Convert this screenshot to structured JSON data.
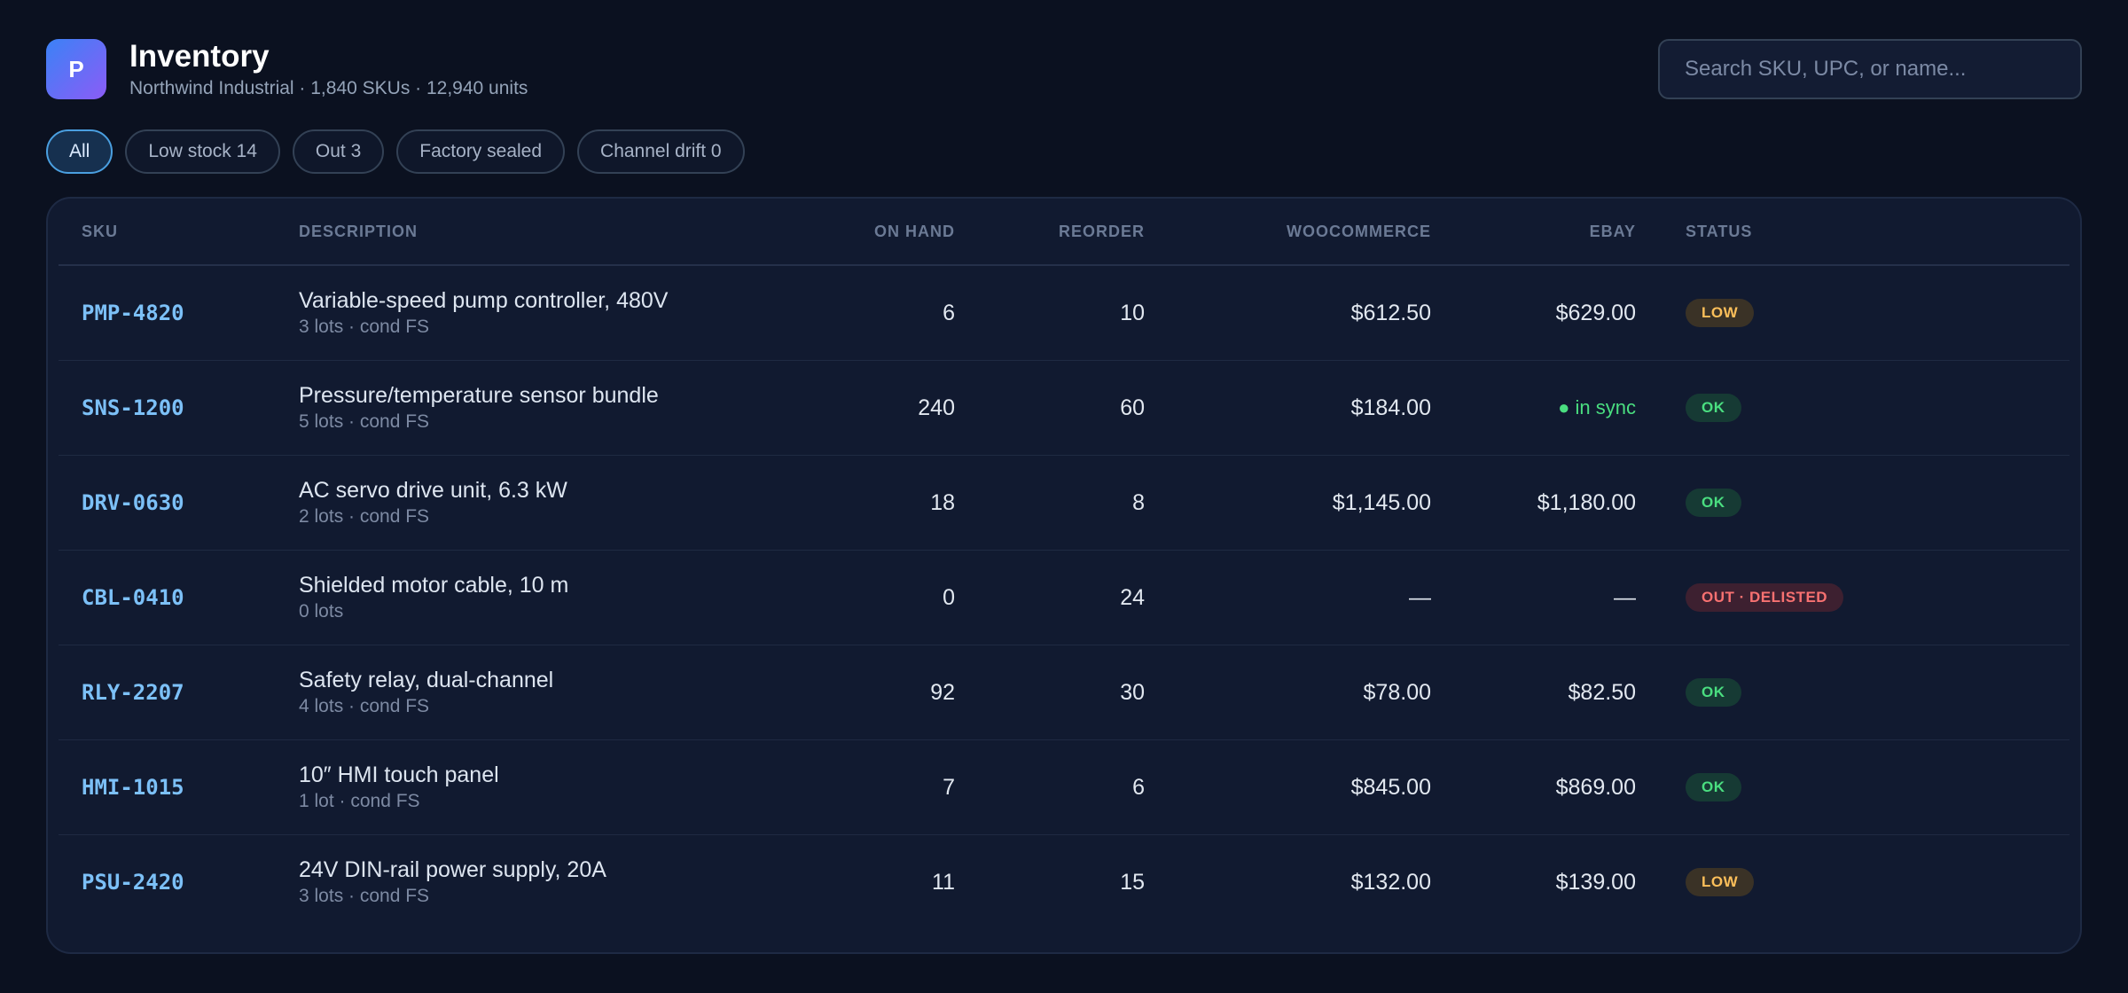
{
  "header": {
    "logo_letter": "P",
    "title": "Inventory",
    "subtitle": "Northwind Industrial · 1,840 SKUs · 12,940 units"
  },
  "search": {
    "placeholder": "Search SKU, UPC, or name..."
  },
  "filters": [
    {
      "label": "All",
      "active": true
    },
    {
      "label": "Low stock 14",
      "active": false
    },
    {
      "label": "Out 3",
      "active": false
    },
    {
      "label": "Factory sealed",
      "active": false
    },
    {
      "label": "Channel drift 0",
      "active": false
    }
  ],
  "table": {
    "columns": [
      "SKU",
      "DESCRIPTION",
      "ON HAND",
      "REORDER",
      "WOOCOMMERCE",
      "EBAY",
      "STATUS"
    ],
    "rows": [
      {
        "sku": "PMP-4820",
        "desc": "Variable-speed pump controller, 480V",
        "sub": "3 lots · cond FS",
        "on_hand": "6",
        "reorder": "10",
        "woo": "$612.50",
        "ebay": "$629.00",
        "status": "LOW",
        "status_kind": "low"
      },
      {
        "sku": "SNS-1200",
        "desc": "Pressure/temperature sensor bundle",
        "sub": "5 lots · cond FS",
        "on_hand": "240",
        "reorder": "60",
        "woo": "$184.00",
        "ebay": "● in sync",
        "status": "OK",
        "status_kind": "ok"
      },
      {
        "sku": "DRV-0630",
        "desc": "AC servo drive unit, 6.3 kW",
        "sub": "2 lots · cond FS",
        "on_hand": "18",
        "reorder": "8",
        "woo": "$1,145.00",
        "ebay": "$1,180.00",
        "status": "OK",
        "status_kind": "ok"
      },
      {
        "sku": "CBL-0410",
        "desc": "Shielded motor cable, 10 m",
        "sub": "0 lots",
        "on_hand": "0",
        "reorder": "24",
        "woo": "—",
        "ebay": "—",
        "status": "OUT · DELISTED",
        "status_kind": "out"
      },
      {
        "sku": "RLY-2207",
        "desc": "Safety relay, dual-channel",
        "sub": "4 lots · cond FS",
        "on_hand": "92",
        "reorder": "30",
        "woo": "$78.00",
        "ebay": "$82.50",
        "status": "OK",
        "status_kind": "ok"
      },
      {
        "sku": "HMI-1015",
        "desc": "10″ HMI touch panel",
        "sub": "1 lot · cond FS",
        "on_hand": "7",
        "reorder": "6",
        "woo": "$845.00",
        "ebay": "$869.00",
        "status": "OK",
        "status_kind": "ok"
      },
      {
        "sku": "PSU-2420",
        "desc": "24V DIN-rail power supply, 20A",
        "sub": "3 lots · cond FS",
        "on_hand": "11",
        "reorder": "15",
        "woo": "$132.00",
        "ebay": "$139.00",
        "status": "LOW",
        "status_kind": "low"
      }
    ]
  },
  "colors": {
    "background": "#0b1120",
    "accent": "#7cc0f7",
    "ok": "#4ade80",
    "low": "#fbbf5a",
    "out": "#f87171"
  }
}
